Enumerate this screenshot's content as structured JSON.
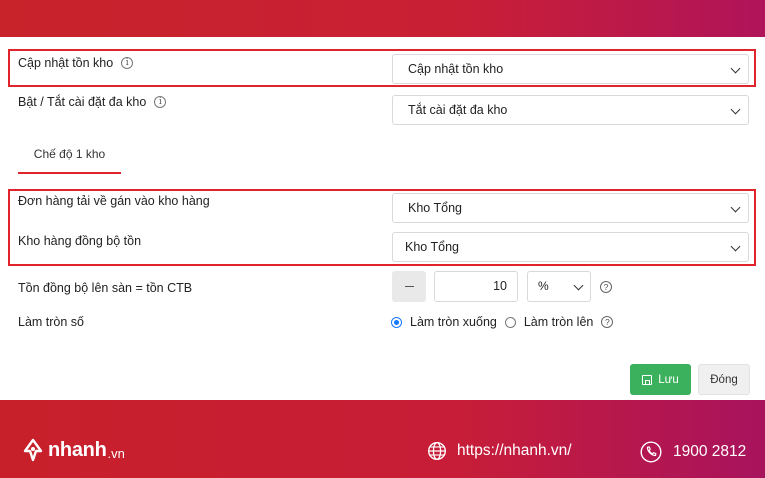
{
  "fields": {
    "update_stock": {
      "label": "Cập nhật tồn kho",
      "value": "Cập nhật tồn kho"
    },
    "multi_warehouse": {
      "label": "Bật / Tắt cài đặt đa kho",
      "value": "Tắt cài đặt đa kho"
    },
    "order_warehouse": {
      "label": "Đơn hàng tải về gán vào kho hàng",
      "value": "Kho Tổng"
    },
    "sync_warehouse": {
      "label": "Kho hàng đồng bộ tồn",
      "value": "Kho Tổng"
    },
    "sync_stock": {
      "label": "Tồn đồng bộ lên sàn = tồn CTB",
      "value": "10",
      "unit": "%"
    },
    "rounding": {
      "label": "Làm tròn số",
      "options": [
        {
          "label": "Làm tròn xuống",
          "selected": true
        },
        {
          "label": "Làm tròn lên",
          "selected": false
        }
      ]
    }
  },
  "tabs": {
    "single_warehouse": "Chế độ 1 kho"
  },
  "buttons": {
    "save": "Lưu",
    "close": "Đóng"
  },
  "footer": {
    "logo_text": "nhanh",
    "logo_suffix": ".vn",
    "website": "https://nhanh.vn/",
    "phone": "1900 2812"
  },
  "icons": {
    "info": "info-icon",
    "help": "help-icon",
    "dropdown": "chevron-down-icon",
    "save": "save-icon",
    "globe": "globe-icon",
    "phone": "phone-icon"
  },
  "colors": {
    "brand_red": "#c8232b",
    "highlight": "#e0242b",
    "save_green": "#3cb15d",
    "radio_blue": "#1677ff"
  }
}
